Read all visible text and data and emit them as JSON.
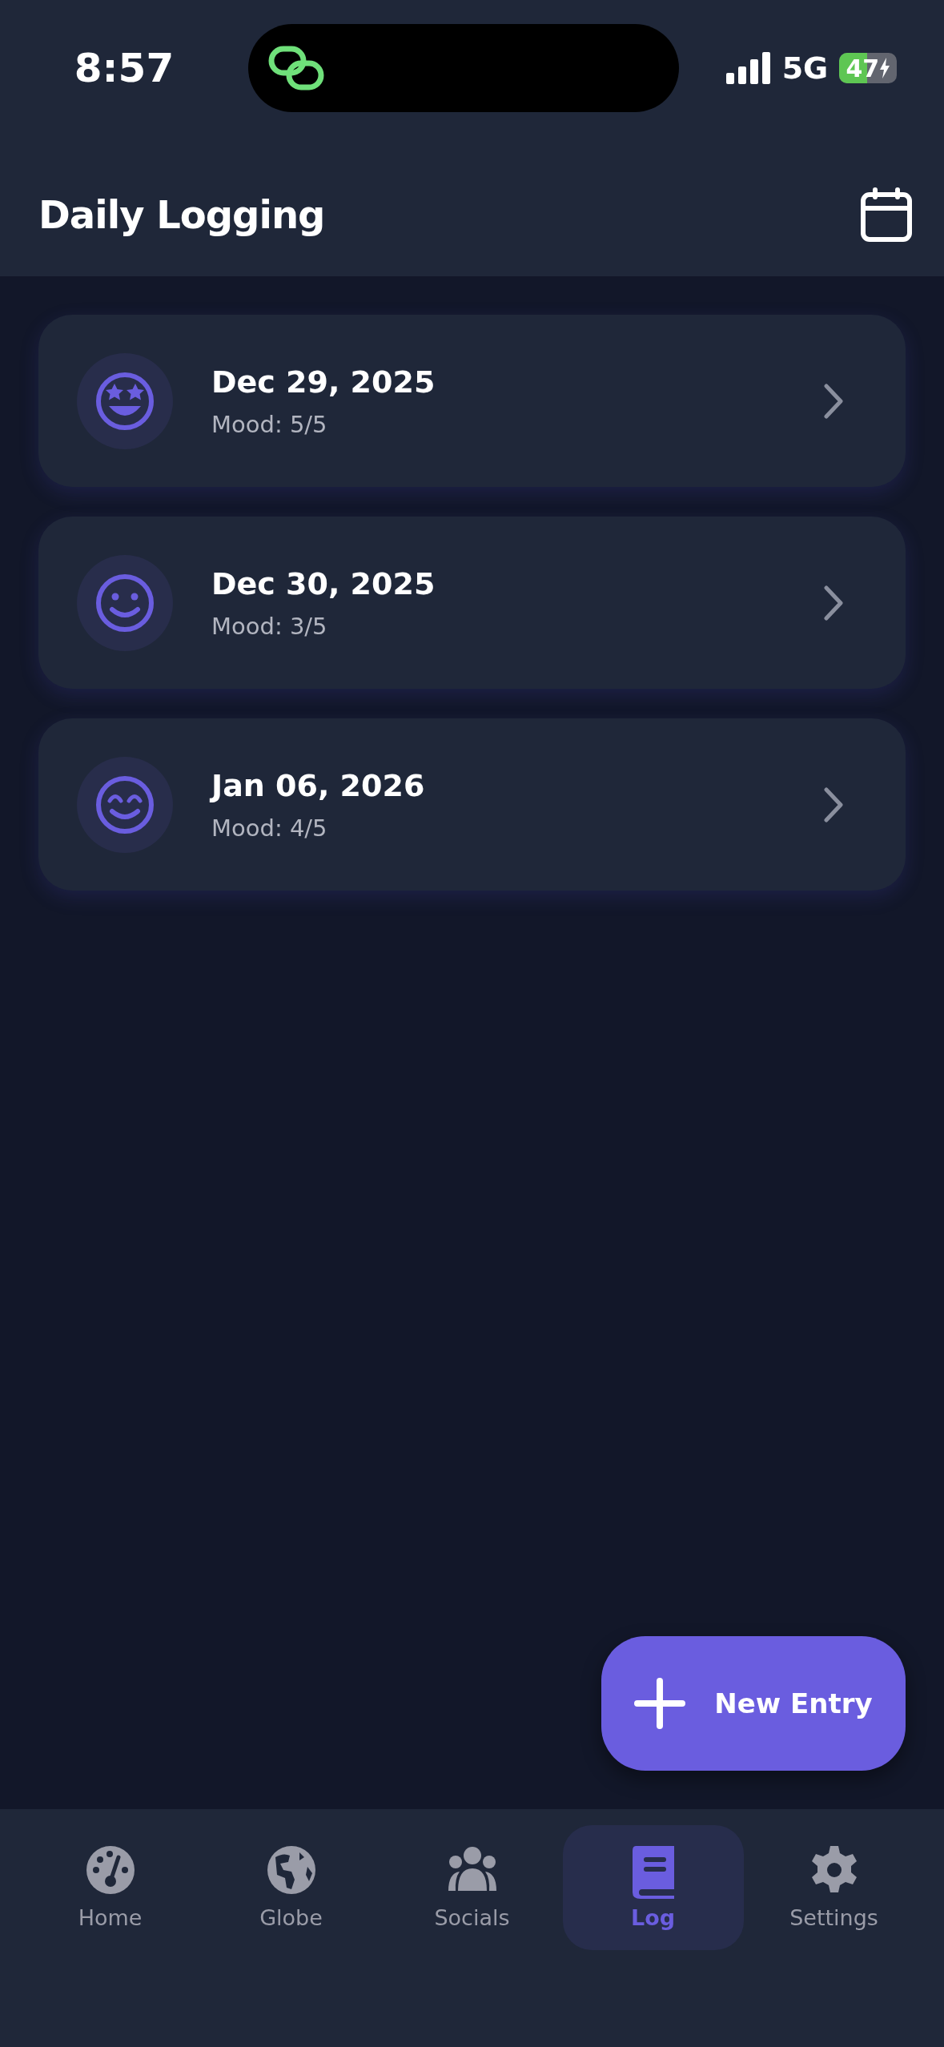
{
  "status_bar": {
    "time": "8:57",
    "network": "5G",
    "battery": "47"
  },
  "header": {
    "title": "Daily Logging"
  },
  "entries": [
    {
      "kind": "star-eyes",
      "date": "Dec 29, 2025",
      "mood": "Mood: 5/5"
    },
    {
      "kind": "smile",
      "date": "Dec 30, 2025",
      "mood": "Mood: 3/5"
    },
    {
      "kind": "happy-eyes",
      "date": "Jan 06, 2026",
      "mood": "Mood: 4/5"
    }
  ],
  "fab": {
    "label": "New Entry"
  },
  "nav": [
    {
      "kind": "gauge",
      "label": "Home",
      "selected": false
    },
    {
      "kind": "globe",
      "label": "Globe",
      "selected": false
    },
    {
      "kind": "people",
      "label": "Socials",
      "selected": false
    },
    {
      "kind": "book",
      "label": "Log",
      "selected": true
    },
    {
      "kind": "gear",
      "label": "Settings",
      "selected": false
    }
  ]
}
